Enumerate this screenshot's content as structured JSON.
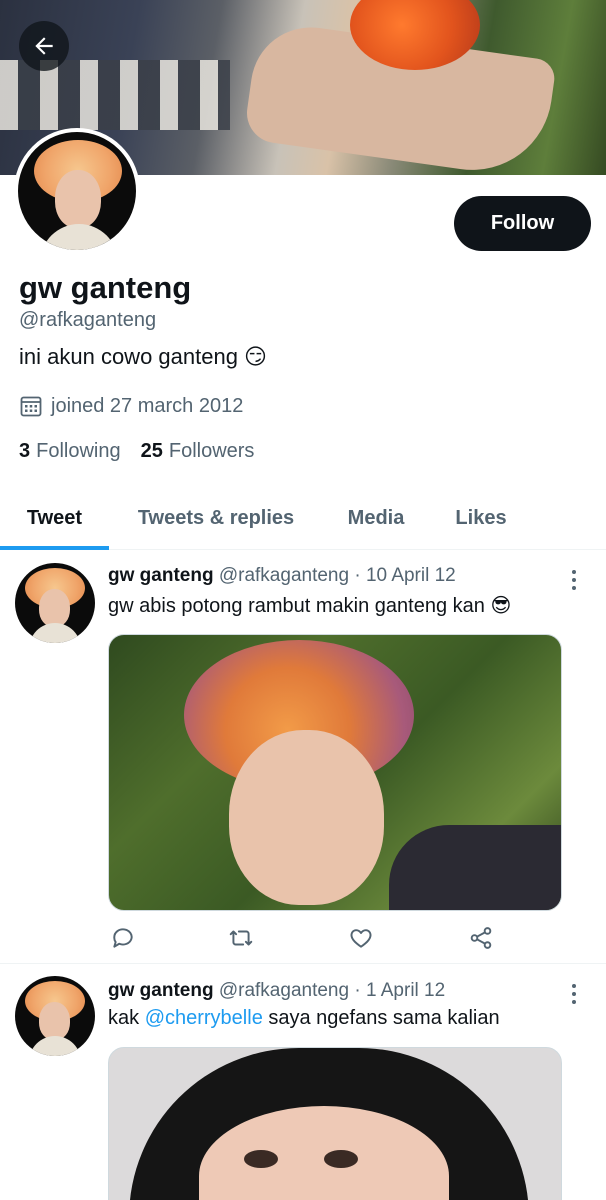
{
  "header": {
    "back_label": "back-arrow-icon"
  },
  "profile": {
    "name": "gw ganteng",
    "handle": "@rafkaganteng",
    "bio": "ini akun cowo ganteng",
    "bio_emoji": "😏",
    "joined": "joined 27 march 2012",
    "following_count": "3",
    "following_label": "Following",
    "followers_count": "25",
    "followers_label": "Followers",
    "follow_button": "Follow"
  },
  "tabs": [
    {
      "label": "Tweet",
      "active": true
    },
    {
      "label": "Tweets & replies",
      "active": false
    },
    {
      "label": "Media",
      "active": false
    },
    {
      "label": "Likes",
      "active": false
    }
  ],
  "tweets": [
    {
      "name": "gw ganteng",
      "handle": "@rafkaganteng",
      "sep": "·",
      "date": "10 April 12",
      "text": "gw abis potong rambut makin ganteng kan",
      "emoji": "😎"
    },
    {
      "name": "gw ganteng",
      "handle": "@rafkaganteng",
      "sep": "·",
      "date": "1 April 12",
      "text_before": "kak",
      "mention": "@cherrybelle",
      "text_after": "saya ngefans sama kalian"
    }
  ],
  "colors": {
    "accent": "#1d9bf0",
    "text": "#0f1419",
    "muted": "#536471",
    "border": "#eff3f4"
  }
}
